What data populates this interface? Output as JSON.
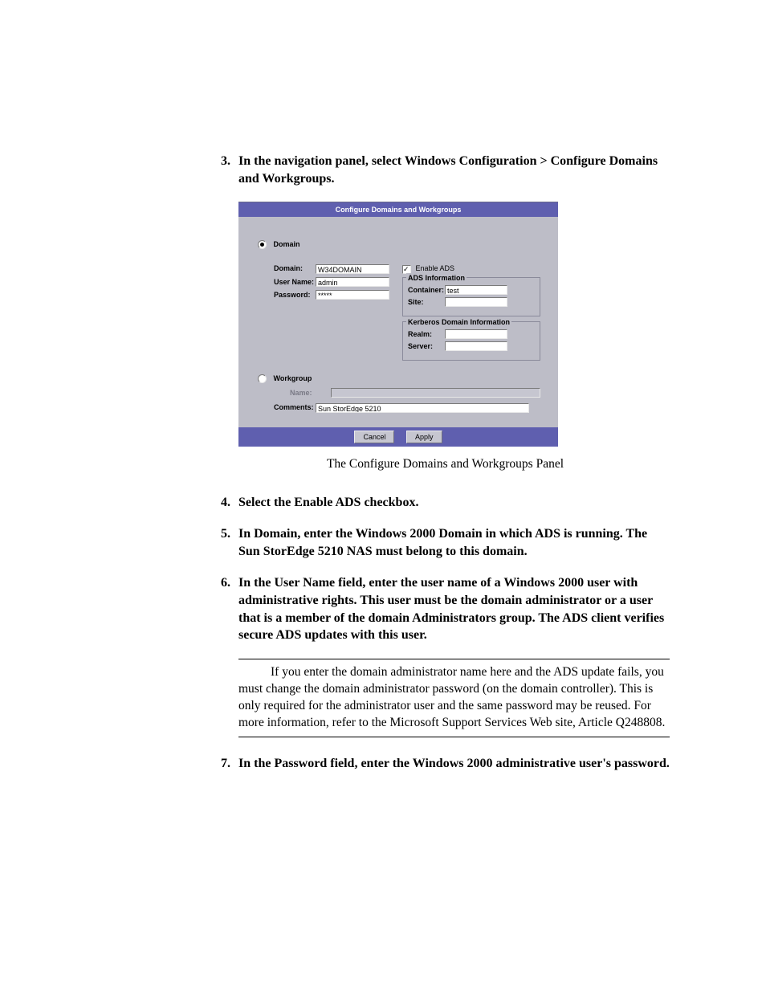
{
  "steps": {
    "s3": {
      "num": "3.",
      "text": "In the navigation panel, select Windows Configuration > Configure Domains and Workgroups."
    },
    "s4": {
      "num": "4.",
      "text": "Select the Enable ADS checkbox."
    },
    "s5": {
      "num": "5.",
      "text": "In Domain, enter the Windows 2000 Domain in which ADS is running. The Sun StorEdge 5210 NAS must belong to this domain."
    },
    "s6": {
      "num": "6.",
      "text": "In the User Name field, enter the user name of a Windows 2000 user with administrative rights. This user must be the domain administrator or a user that is a member of the domain Administrators group. The ADS client verifies secure ADS updates with this user."
    },
    "s7": {
      "num": "7.",
      "text": "In the Password field, enter the Windows 2000 administrative user's password."
    }
  },
  "figure_caption": "The Configure Domains and Workgroups Panel",
  "note": "If you enter the domain administrator name here and the ADS update fails, you must change the domain administrator password (on the domain controller). This is only required for the administrator user and the same password may be reused. For more information, refer to the Microsoft Support Services Web site, Article Q248808.",
  "panel": {
    "title": "Configure Domains and Workgroups",
    "domain_radio_label": "Domain",
    "domain_label": "Domain:",
    "domain_value": "W34DOMAIN",
    "username_label": "User Name:",
    "username_value": "admin",
    "password_label": "Password:",
    "password_value": "*****",
    "enable_ads_label": "Enable ADS",
    "ads_info_legend": "ADS Information",
    "container_label": "Container:",
    "container_value": "test",
    "site_label": "Site:",
    "kerberos_legend": "Kerberos Domain Information",
    "realm_label": "Realm:",
    "server_label": "Server:",
    "workgroup_radio_label": "Workgroup",
    "name_label": "Name:",
    "comments_label": "Comments:",
    "comments_value": "Sun StorEdge 5210",
    "cancel_btn": "Cancel",
    "apply_btn": "Apply"
  }
}
